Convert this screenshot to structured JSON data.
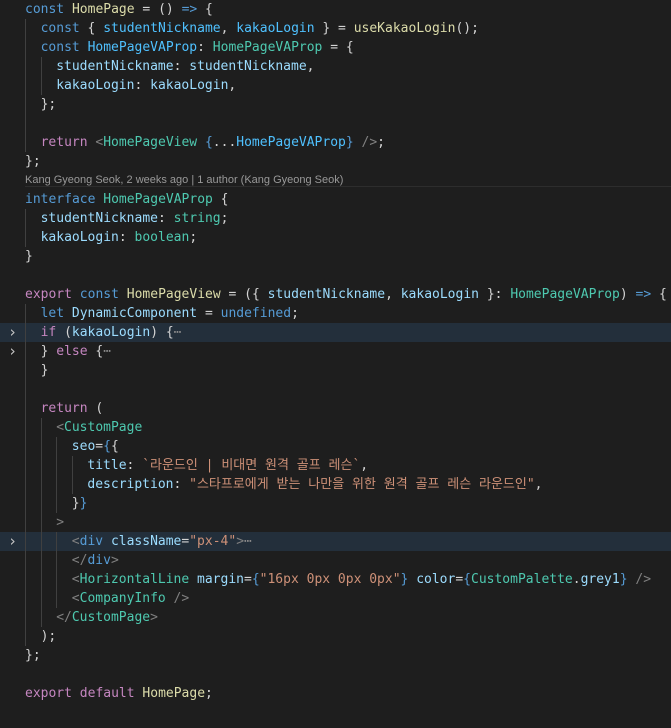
{
  "editor": {
    "colors": {
      "background": "#1e1e1e",
      "line_highlight": "#232f3b",
      "keyword": "#569cd6",
      "control": "#c586c0",
      "function": "#dcdcaa",
      "variable": "#9cdcfe",
      "type": "#4ec9b0",
      "string": "#ce9178"
    },
    "fold_icon": "chevron-right-icon",
    "codelens": "Kang Gyeong Seok, 2 weeks ago | 1 author (Kang Gyeong Seok)",
    "lines": [
      {
        "tokens": [
          [
            "kw",
            "const"
          ],
          [
            "txt",
            " "
          ],
          [
            "fn",
            "HomePage"
          ],
          [
            "txt",
            " = () "
          ],
          [
            "kw",
            "=>"
          ],
          [
            "txt",
            " {"
          ]
        ]
      },
      {
        "guides": 1,
        "tokens": [
          [
            "kw",
            "const"
          ],
          [
            "txt",
            " { "
          ],
          [
            "cst",
            "studentNickname"
          ],
          [
            "txt",
            ", "
          ],
          [
            "cst",
            "kakaoLogin"
          ],
          [
            "txt",
            " } = "
          ],
          [
            "fn",
            "useKakaoLogin"
          ],
          [
            "txt",
            "();"
          ]
        ]
      },
      {
        "guides": 1,
        "tokens": [
          [
            "kw",
            "const"
          ],
          [
            "txt",
            " "
          ],
          [
            "cst",
            "HomePageVAProp"
          ],
          [
            "txt",
            ": "
          ],
          [
            "ty",
            "HomePageVAProp"
          ],
          [
            "txt",
            " = {"
          ]
        ]
      },
      {
        "guides": 2,
        "tokens": [
          [
            "var",
            "studentNickname"
          ],
          [
            "txt",
            ": "
          ],
          [
            "var",
            "studentNickname"
          ],
          [
            "txt",
            ","
          ]
        ]
      },
      {
        "guides": 2,
        "tokens": [
          [
            "var",
            "kakaoLogin"
          ],
          [
            "txt",
            ": "
          ],
          [
            "var",
            "kakaoLogin"
          ],
          [
            "txt",
            ","
          ]
        ]
      },
      {
        "guides": 1,
        "tokens": [
          [
            "txt",
            "};"
          ]
        ]
      },
      {
        "guides": 1,
        "tokens": []
      },
      {
        "guides": 1,
        "tokens": [
          [
            "ctl",
            "return"
          ],
          [
            "txt",
            " "
          ],
          [
            "tag",
            "<"
          ],
          [
            "ty",
            "HomePageView"
          ],
          [
            "txt",
            " "
          ],
          [
            "kw",
            "{"
          ],
          [
            "txt",
            "..."
          ],
          [
            "cst",
            "HomePageVAProp"
          ],
          [
            "kw",
            "}"
          ],
          [
            "txt",
            " "
          ],
          [
            "tag",
            "/>"
          ],
          [
            "txt",
            ";"
          ]
        ]
      },
      {
        "tokens": [
          [
            "txt",
            "};"
          ]
        ]
      },
      {
        "codelens": true,
        "tokens": []
      },
      {
        "tokens": [
          [
            "kw",
            "interface"
          ],
          [
            "txt",
            " "
          ],
          [
            "ty",
            "HomePageVAProp"
          ],
          [
            "txt",
            " {"
          ]
        ]
      },
      {
        "guides": 1,
        "tokens": [
          [
            "var",
            "studentNickname"
          ],
          [
            "txt",
            ": "
          ],
          [
            "ty",
            "string"
          ],
          [
            "txt",
            ";"
          ]
        ]
      },
      {
        "guides": 1,
        "tokens": [
          [
            "var",
            "kakaoLogin"
          ],
          [
            "txt",
            ": "
          ],
          [
            "ty",
            "boolean"
          ],
          [
            "txt",
            ";"
          ]
        ]
      },
      {
        "tokens": [
          [
            "txt",
            "}"
          ]
        ]
      },
      {
        "tokens": []
      },
      {
        "tokens": [
          [
            "ctl",
            "export"
          ],
          [
            "txt",
            " "
          ],
          [
            "kw",
            "const"
          ],
          [
            "txt",
            " "
          ],
          [
            "fn",
            "HomePageView"
          ],
          [
            "txt",
            " = ({ "
          ],
          [
            "var",
            "studentNickname"
          ],
          [
            "txt",
            ", "
          ],
          [
            "var",
            "kakaoLogin"
          ],
          [
            "txt",
            " }: "
          ],
          [
            "ty",
            "HomePageVAProp"
          ],
          [
            "txt",
            ") "
          ],
          [
            "kw",
            "=>"
          ],
          [
            "txt",
            " {"
          ]
        ]
      },
      {
        "guides": 1,
        "tokens": [
          [
            "kw",
            "let"
          ],
          [
            "txt",
            " "
          ],
          [
            "var",
            "DynamicComponent"
          ],
          [
            "txt",
            " = "
          ],
          [
            "kw",
            "undefined"
          ],
          [
            "txt",
            ";"
          ]
        ]
      },
      {
        "guides": 1,
        "fold": true,
        "hl": true,
        "tokens": [
          [
            "ctl",
            "if"
          ],
          [
            "txt",
            " ("
          ],
          [
            "var",
            "kakaoLogin"
          ],
          [
            "txt",
            ") {"
          ],
          [
            "ell",
            "⋯"
          ]
        ]
      },
      {
        "guides": 1,
        "fold": true,
        "tokens": [
          [
            "txt",
            "} "
          ],
          [
            "ctl",
            "else"
          ],
          [
            "txt",
            " {"
          ],
          [
            "ell",
            "⋯"
          ]
        ]
      },
      {
        "guides": 1,
        "tokens": [
          [
            "txt",
            "}"
          ]
        ]
      },
      {
        "guides": 1,
        "tokens": []
      },
      {
        "guides": 1,
        "tokens": [
          [
            "ctl",
            "return"
          ],
          [
            "txt",
            " ("
          ]
        ]
      },
      {
        "guides": 2,
        "tokens": [
          [
            "tag",
            "<"
          ],
          [
            "ty",
            "CustomPage"
          ]
        ]
      },
      {
        "guides": 3,
        "tokens": [
          [
            "var",
            "seo"
          ],
          [
            "txt",
            "="
          ],
          [
            "kw",
            "{"
          ],
          [
            "txt",
            "{"
          ]
        ]
      },
      {
        "guides": 4,
        "tokens": [
          [
            "var",
            "title"
          ],
          [
            "txt",
            ": "
          ],
          [
            "str",
            "`라운드인 | 비대면 원격 골프 레슨`"
          ],
          [
            "txt",
            ","
          ]
        ]
      },
      {
        "guides": 4,
        "tokens": [
          [
            "var",
            "description"
          ],
          [
            "txt",
            ": "
          ],
          [
            "str",
            "\"스타프로에게 받는 나만을 위한 원격 골프 레슨 라운드인\""
          ],
          [
            "txt",
            ","
          ]
        ]
      },
      {
        "guides": 3,
        "tokens": [
          [
            "txt",
            "}"
          ],
          [
            "kw",
            "}"
          ]
        ]
      },
      {
        "guides": 2,
        "tokens": [
          [
            "tag",
            ">"
          ]
        ]
      },
      {
        "guides": 3,
        "fold": true,
        "hl": true,
        "tokens": [
          [
            "tag",
            "<"
          ],
          [
            "kw",
            "div"
          ],
          [
            "txt",
            " "
          ],
          [
            "var",
            "className"
          ],
          [
            "txt",
            "="
          ],
          [
            "str",
            "\"px-4\""
          ],
          [
            "tag",
            ">"
          ],
          [
            "ell",
            "⋯"
          ]
        ]
      },
      {
        "guides": 3,
        "tokens": [
          [
            "tag",
            "</"
          ],
          [
            "kw",
            "div"
          ],
          [
            "tag",
            ">"
          ]
        ]
      },
      {
        "guides": 3,
        "tokens": [
          [
            "tag",
            "<"
          ],
          [
            "ty",
            "HorizontalLine"
          ],
          [
            "txt",
            " "
          ],
          [
            "var",
            "margin"
          ],
          [
            "txt",
            "="
          ],
          [
            "kw",
            "{"
          ],
          [
            "str",
            "\"16px 0px 0px 0px\""
          ],
          [
            "kw",
            "}"
          ],
          [
            "txt",
            " "
          ],
          [
            "var",
            "color"
          ],
          [
            "txt",
            "="
          ],
          [
            "kw",
            "{"
          ],
          [
            "ty",
            "CustomPalette"
          ],
          [
            "txt",
            "."
          ],
          [
            "var",
            "grey1"
          ],
          [
            "kw",
            "}"
          ],
          [
            "txt",
            " "
          ],
          [
            "tag",
            "/>"
          ]
        ]
      },
      {
        "guides": 3,
        "tokens": [
          [
            "tag",
            "<"
          ],
          [
            "ty",
            "CompanyInfo"
          ],
          [
            "txt",
            " "
          ],
          [
            "tag",
            "/>"
          ]
        ]
      },
      {
        "guides": 2,
        "tokens": [
          [
            "tag",
            "</"
          ],
          [
            "ty",
            "CustomPage"
          ],
          [
            "tag",
            ">"
          ]
        ]
      },
      {
        "guides": 1,
        "tokens": [
          [
            "txt",
            ");"
          ]
        ]
      },
      {
        "tokens": [
          [
            "txt",
            "};"
          ]
        ]
      },
      {
        "tokens": []
      },
      {
        "tokens": [
          [
            "ctl",
            "export"
          ],
          [
            "txt",
            " "
          ],
          [
            "ctl",
            "default"
          ],
          [
            "txt",
            " "
          ],
          [
            "fn",
            "HomePage"
          ],
          [
            "txt",
            ";"
          ]
        ]
      }
    ]
  }
}
